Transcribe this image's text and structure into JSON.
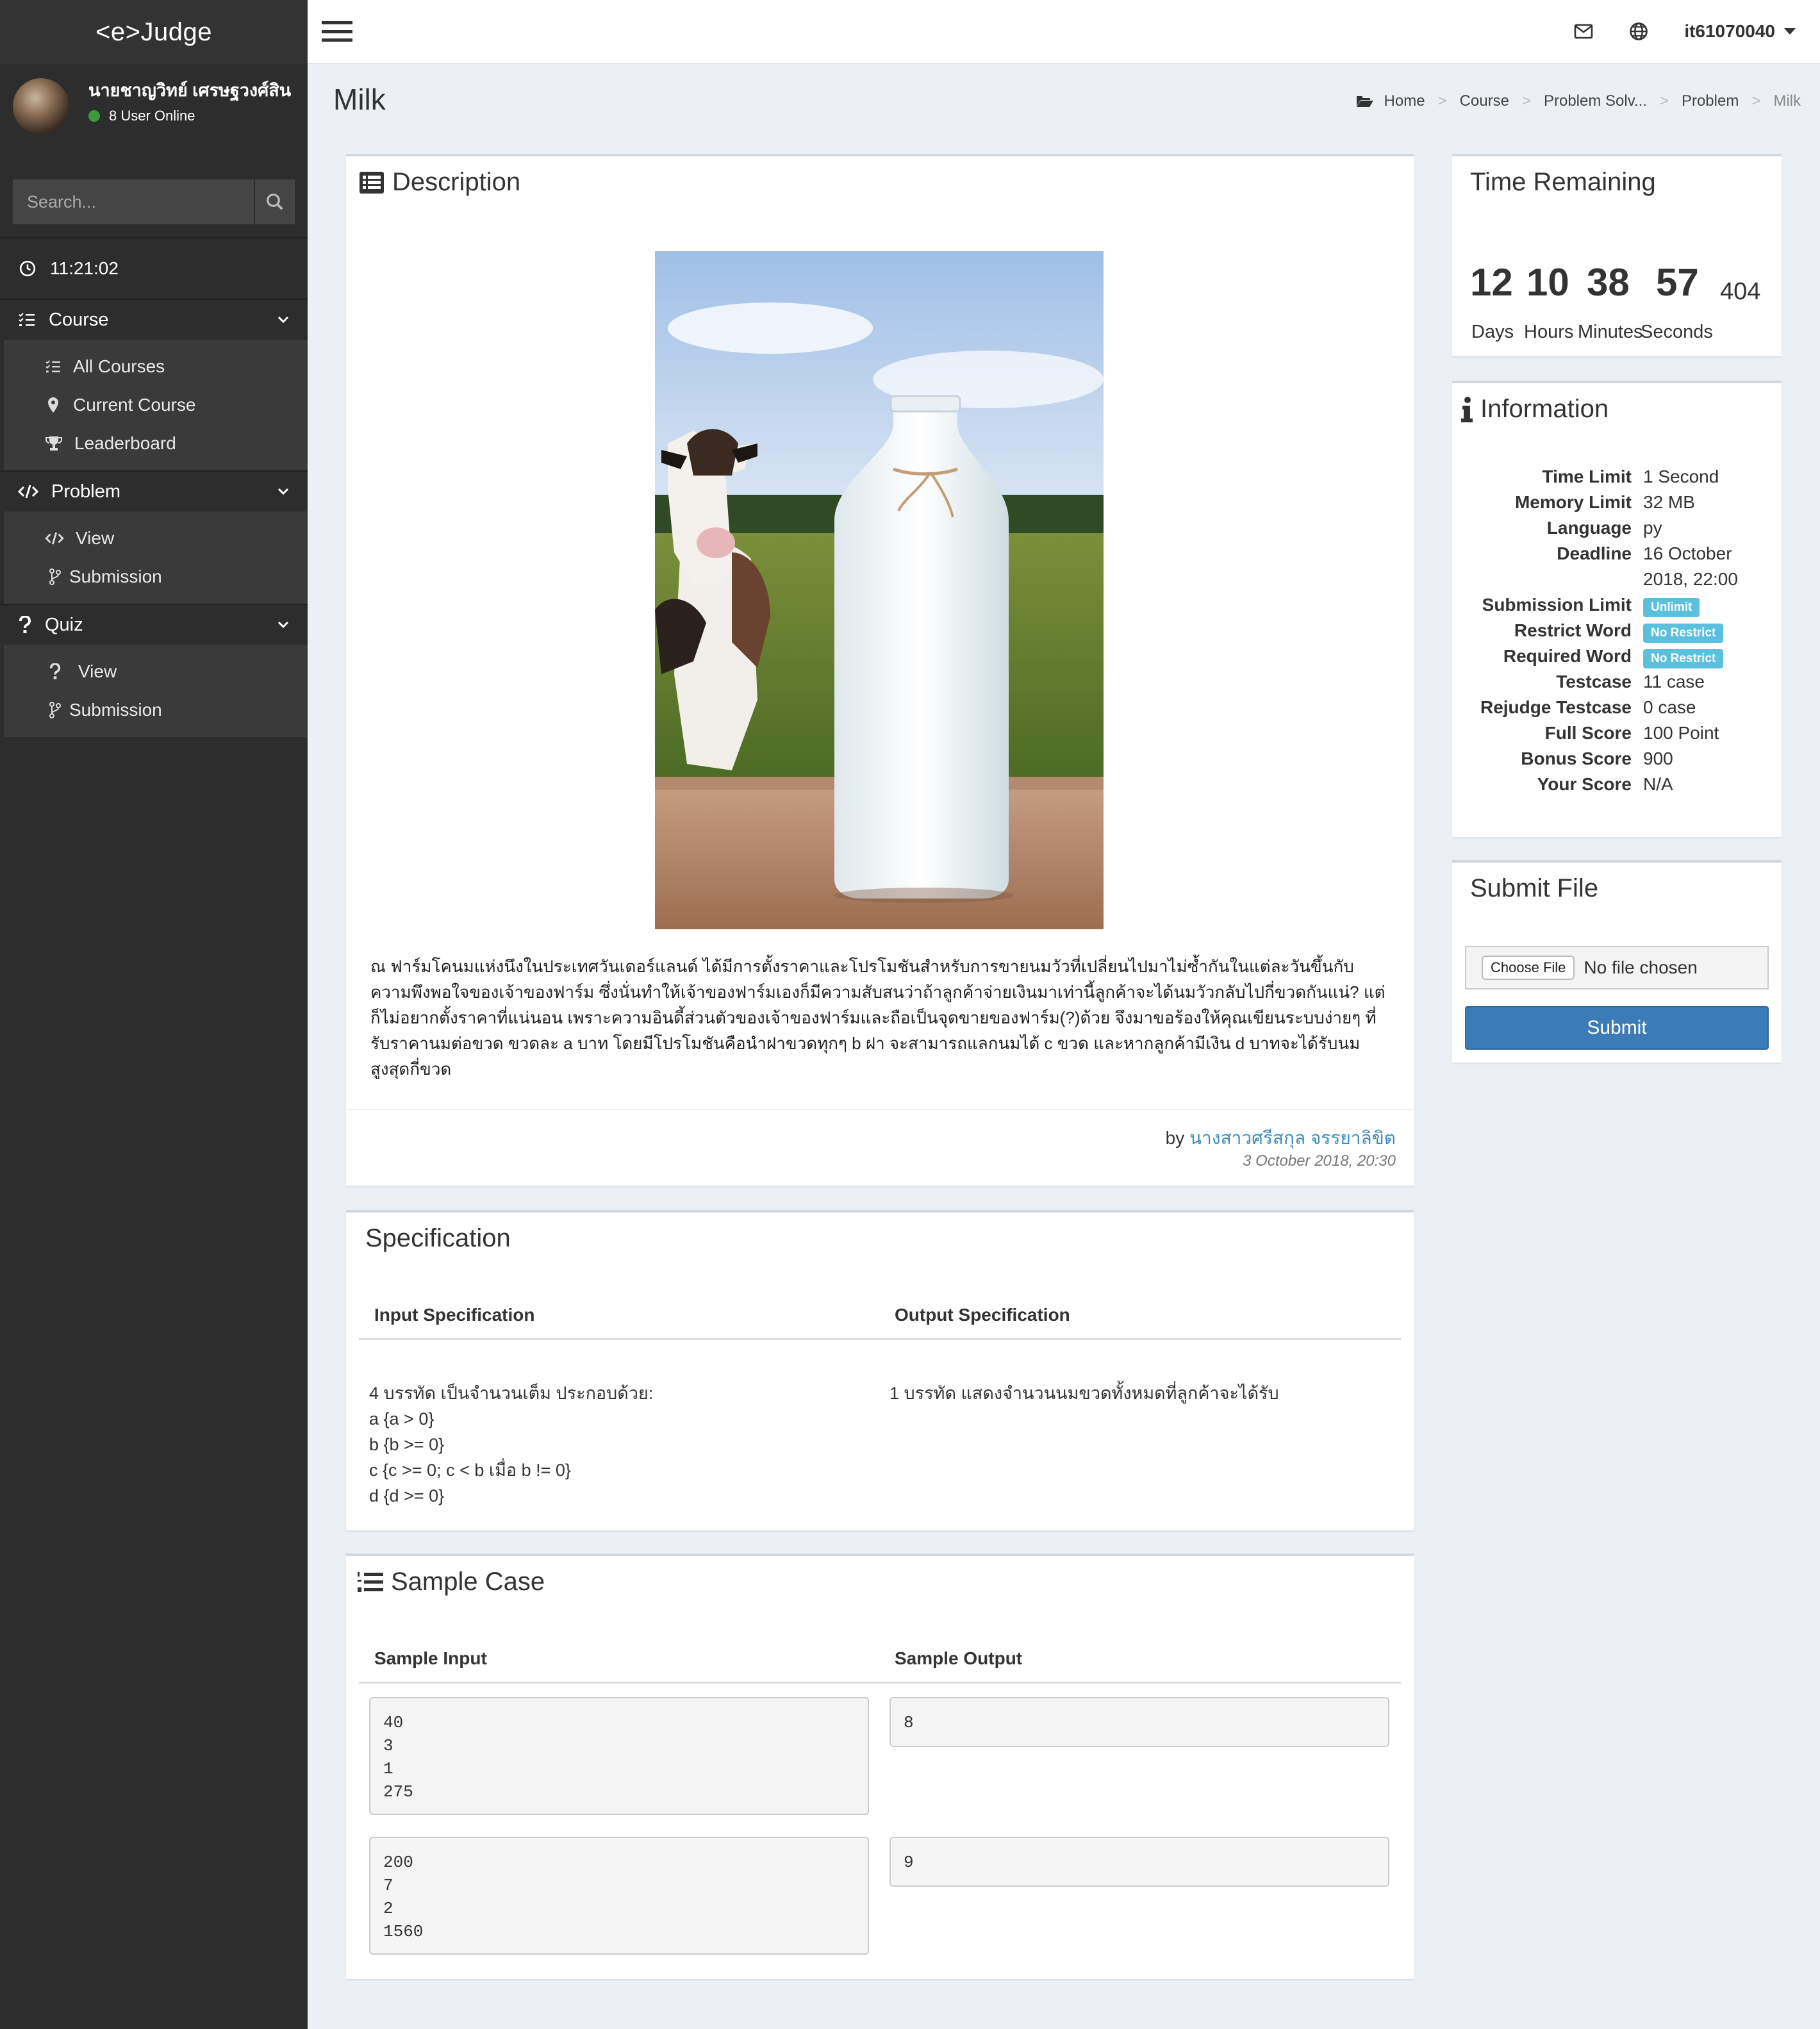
{
  "app": {
    "logo": "<e>Judge"
  },
  "user": {
    "name": "นายชาญวิทย์ เศรษฐวงศ์สิน",
    "online": "8 User Online",
    "top_username": "it61070040"
  },
  "search": {
    "placeholder": "Search..."
  },
  "clock": "11:21:02",
  "sidebar": {
    "course": {
      "label": "Course",
      "items": [
        "All Courses",
        "Current Course",
        "Leaderboard"
      ]
    },
    "problem": {
      "label": "Problem",
      "items": [
        "View",
        "Submission"
      ]
    },
    "quiz": {
      "label": "Quiz",
      "items": [
        "View",
        "Submission"
      ]
    }
  },
  "page": {
    "title": "Milk"
  },
  "breadcrumb": [
    "Home",
    "Course",
    "Problem Solv...",
    "Problem",
    "Milk"
  ],
  "description": {
    "title": "Description",
    "text": "ณ ฟาร์มโคนมแห่งนึงในประเทศวันเดอร์แลนด์ ได้มีการตั้งราคาและโปรโมชันสำหรับการขายนมวัวที่เปลี่ยนไปมาไม่ซ้ำกันในแต่ละวันขึ้นกับความพึงพอใจของเจ้าของฟาร์ม ซึ่งนั่นทำให้เจ้าของฟาร์มเองก็มีความสับสนว่าถ้าลูกค้าจ่ายเงินมาเท่านี้ลูกค้าจะได้นมวัวกลับไปกี่ขวดกันแน่? แต่ก็ไม่อยากตั้งราคาที่แน่นอน เพราะความอินดี้ส่วนตัวของเจ้าของฟาร์มและถือเป็นจุดขายของฟาร์ม(?)ด้วย จึงมาขอร้องให้คุณเขียนระบบง่ายๆ ที่รับราคานมต่อขวด ขวดละ a บาท โดยมีโปรโมชันคือนำฝาขวดทุกๆ b ฝา จะสามารถแลกนมได้ c ขวด และหากลูกค้ามีเงิน d บาทจะได้รับนมสูงสุดกี่ขวด",
    "by_prefix": "by",
    "author": "นางสาวศรีสกุล จรรยาลิขิต",
    "date": "3 October 2018, 20:30"
  },
  "specification": {
    "title": "Specification",
    "input_header": "Input Specification",
    "output_header": "Output Specification",
    "input_lines": [
      "4 บรรทัด เป็นจำนวนเต็ม ประกอบด้วย:",
      "a {a > 0}",
      "b {b >= 0}",
      "c {c >= 0; c < b เมื่อ b != 0}",
      "d {d >= 0}"
    ],
    "output_text": "1 บรรทัด แสดงจำนวนนมขวดทั้งหมดที่ลูกค้าจะได้รับ"
  },
  "sample": {
    "title": "Sample Case",
    "input_header": "Sample Input",
    "output_header": "Sample Output",
    "cases": [
      {
        "input": "40\n3\n1\n275",
        "output": "8"
      },
      {
        "input": "200\n7\n2\n1560",
        "output": "9"
      }
    ]
  },
  "timer": {
    "title": "Time Remaining",
    "days": "12",
    "hours": "10",
    "minutes": "38",
    "seconds": "57",
    "ms": "404",
    "labels": [
      "Days",
      "Hours",
      "Minutes",
      "Seconds"
    ]
  },
  "information": {
    "title": "Information",
    "rows": [
      {
        "key": "Time Limit",
        "value": "1 Second"
      },
      {
        "key": "Memory Limit",
        "value": "32 MB"
      },
      {
        "key": "Language",
        "value": "py"
      },
      {
        "key": "Deadline",
        "value": "16 October",
        "value2": "2018, 22:00"
      },
      {
        "key": "Submission Limit",
        "badge": "Unlimit"
      },
      {
        "key": "Restrict Word",
        "badge": "No Restrict"
      },
      {
        "key": "Required Word",
        "badge": "No Restrict"
      },
      {
        "key": "Testcase",
        "value": "11 case"
      },
      {
        "key": "Rejudge Testcase",
        "value": "0 case"
      },
      {
        "key": "Full Score",
        "value": "100 Point"
      },
      {
        "key": "Bonus Score",
        "value": "900"
      },
      {
        "key": "Your Score",
        "value": "N/A"
      }
    ]
  },
  "submit": {
    "title": "Submit File",
    "choose_label": "Choose File",
    "no_file": "No file chosen",
    "submit_label": "Submit"
  },
  "colors": {
    "sidebar": "#2d2d2d",
    "accent": "#3c8dbc",
    "submit": "#3c7cb6",
    "badge": "#5bc0de"
  }
}
